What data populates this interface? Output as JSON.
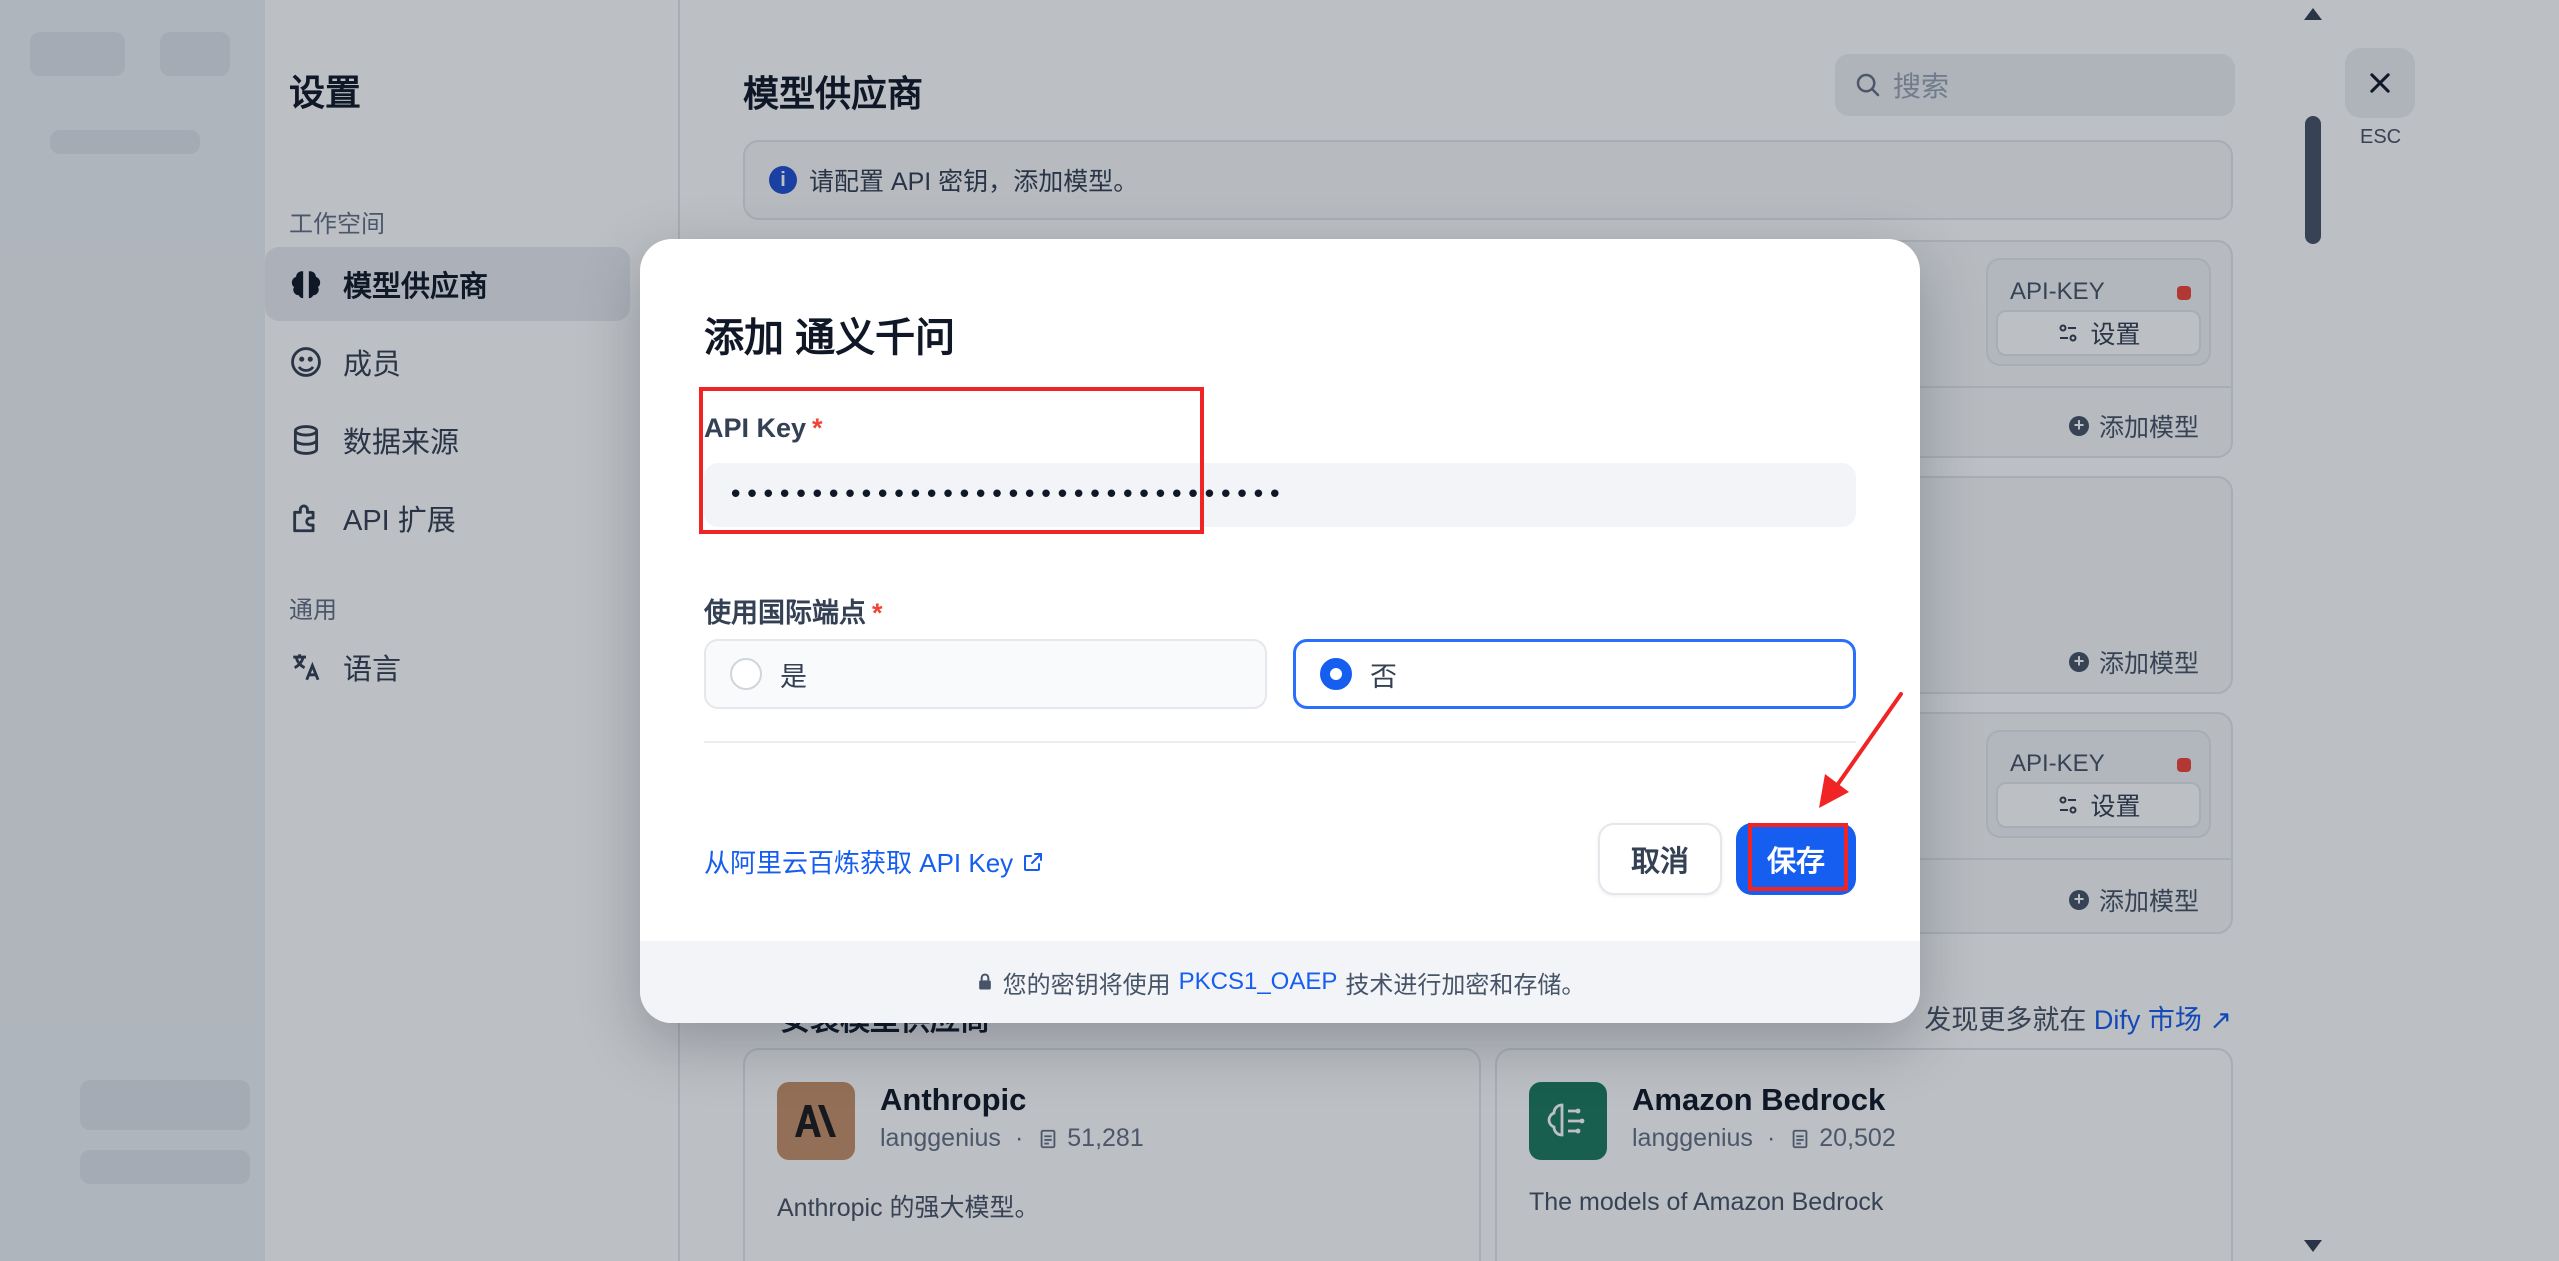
{
  "settings_nav": {
    "title": "设置",
    "workspace_section": "工作空间",
    "general_section": "通用",
    "items": [
      {
        "label": "模型供应商",
        "icon": "brain-icon",
        "active": true
      },
      {
        "label": "成员",
        "icon": "members-icon",
        "active": false
      },
      {
        "label": "数据来源",
        "icon": "database-icon",
        "active": false
      },
      {
        "label": "API 扩展",
        "icon": "puzzle-icon",
        "active": false
      }
    ],
    "general_items": [
      {
        "label": "语言",
        "icon": "translate-icon"
      }
    ]
  },
  "main": {
    "title": "模型供应商",
    "search_placeholder": "搜索",
    "hint": "请配置 API 密钥，添加模型。",
    "providers": [
      {
        "api_key_label": "API-KEY",
        "set_label": "设置",
        "add_model_label": "添加模型",
        "status_color": "#f04438"
      },
      {
        "add_model_label": "添加模型"
      },
      {
        "api_key_label": "API-KEY",
        "set_label": "设置",
        "add_model_label": "添加模型",
        "status_color": "#f04438"
      }
    ],
    "install_section_title": "安装模型供应商",
    "discover_prefix": "发现更多就在",
    "discover_link": "Dify 市场",
    "marketplace": [
      {
        "name": "Anthropic",
        "author": "langgenius",
        "downloads": "51,281",
        "description": "Anthropic 的强大模型。",
        "logo_color": "#c8916a"
      },
      {
        "name": "Amazon Bedrock",
        "author": "langgenius",
        "downloads": "20,502",
        "description": "The models of Amazon Bedrock",
        "logo_color": "#1d7a5f"
      }
    ]
  },
  "esc": {
    "label": "ESC"
  },
  "modal": {
    "title": "添加 通义千问",
    "api_key_label": "API Key",
    "required_mark": "*",
    "api_key_value": "••••••••••••••••••••••••••••••••••",
    "endpoint_label": "使用国际端点",
    "options": [
      {
        "label": "是",
        "selected": false
      },
      {
        "label": "否",
        "selected": true
      }
    ],
    "get_key_link": "从阿里云百炼获取 API Key",
    "cancel_label": "取消",
    "save_label": "保存",
    "footer_prefix": "您的密钥将使用",
    "footer_accent": "PKCS1_OAEP",
    "footer_suffix": "技术进行加密和存储。"
  },
  "colors": {
    "accent": "#155eef",
    "annotation_red": "#f02424"
  }
}
